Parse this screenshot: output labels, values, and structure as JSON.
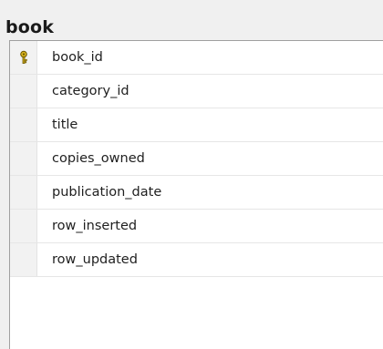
{
  "table": {
    "name": "book",
    "columns": [
      {
        "name": "book_id",
        "icon": "primary-key-icon"
      },
      {
        "name": "category_id"
      },
      {
        "name": "title"
      },
      {
        "name": "copies_owned"
      },
      {
        "name": "publication_date"
      },
      {
        "name": "row_inserted"
      },
      {
        "name": "row_updated"
      }
    ]
  },
  "colors": {
    "key_gold": "#d7b21d",
    "key_outline": "#6b5600",
    "header_bg": "#f0f0f0"
  }
}
